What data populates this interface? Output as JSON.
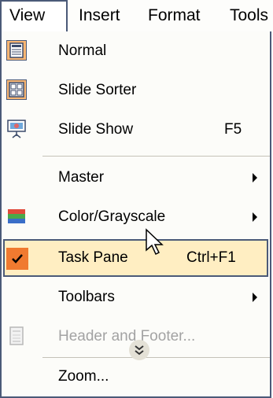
{
  "menubar": {
    "items": [
      {
        "label": "View"
      },
      {
        "label": "Insert"
      },
      {
        "label": "Format"
      },
      {
        "label": "Tools"
      }
    ]
  },
  "menu": {
    "items": [
      {
        "label": "Normal",
        "icon": "normal-view-icon"
      },
      {
        "label": "Slide Sorter",
        "icon": "slide-sorter-icon"
      },
      {
        "label": "Slide Show",
        "shortcut": "F5",
        "icon": "slide-show-icon"
      },
      {
        "label": "Master",
        "submenu": true
      },
      {
        "label": "Color/Grayscale",
        "submenu": true,
        "icon": "color-grayscale-icon"
      },
      {
        "label": "Task Pane",
        "shortcut": "Ctrl+F1",
        "checked": true,
        "highlighted": true,
        "icon": "checkmark-icon"
      },
      {
        "label": "Toolbars",
        "submenu": true
      },
      {
        "label": "Header and Footer...",
        "disabled": true,
        "icon": "header-footer-icon"
      },
      {
        "label": "Zoom..."
      }
    ],
    "expand_icon": "double-chevron-down-icon"
  },
  "colors": {
    "highlight_bg": "#ffeec2",
    "check_bg": "#f07a30",
    "border": "#4b5a78",
    "disabled_text": "#a3a3a3"
  }
}
